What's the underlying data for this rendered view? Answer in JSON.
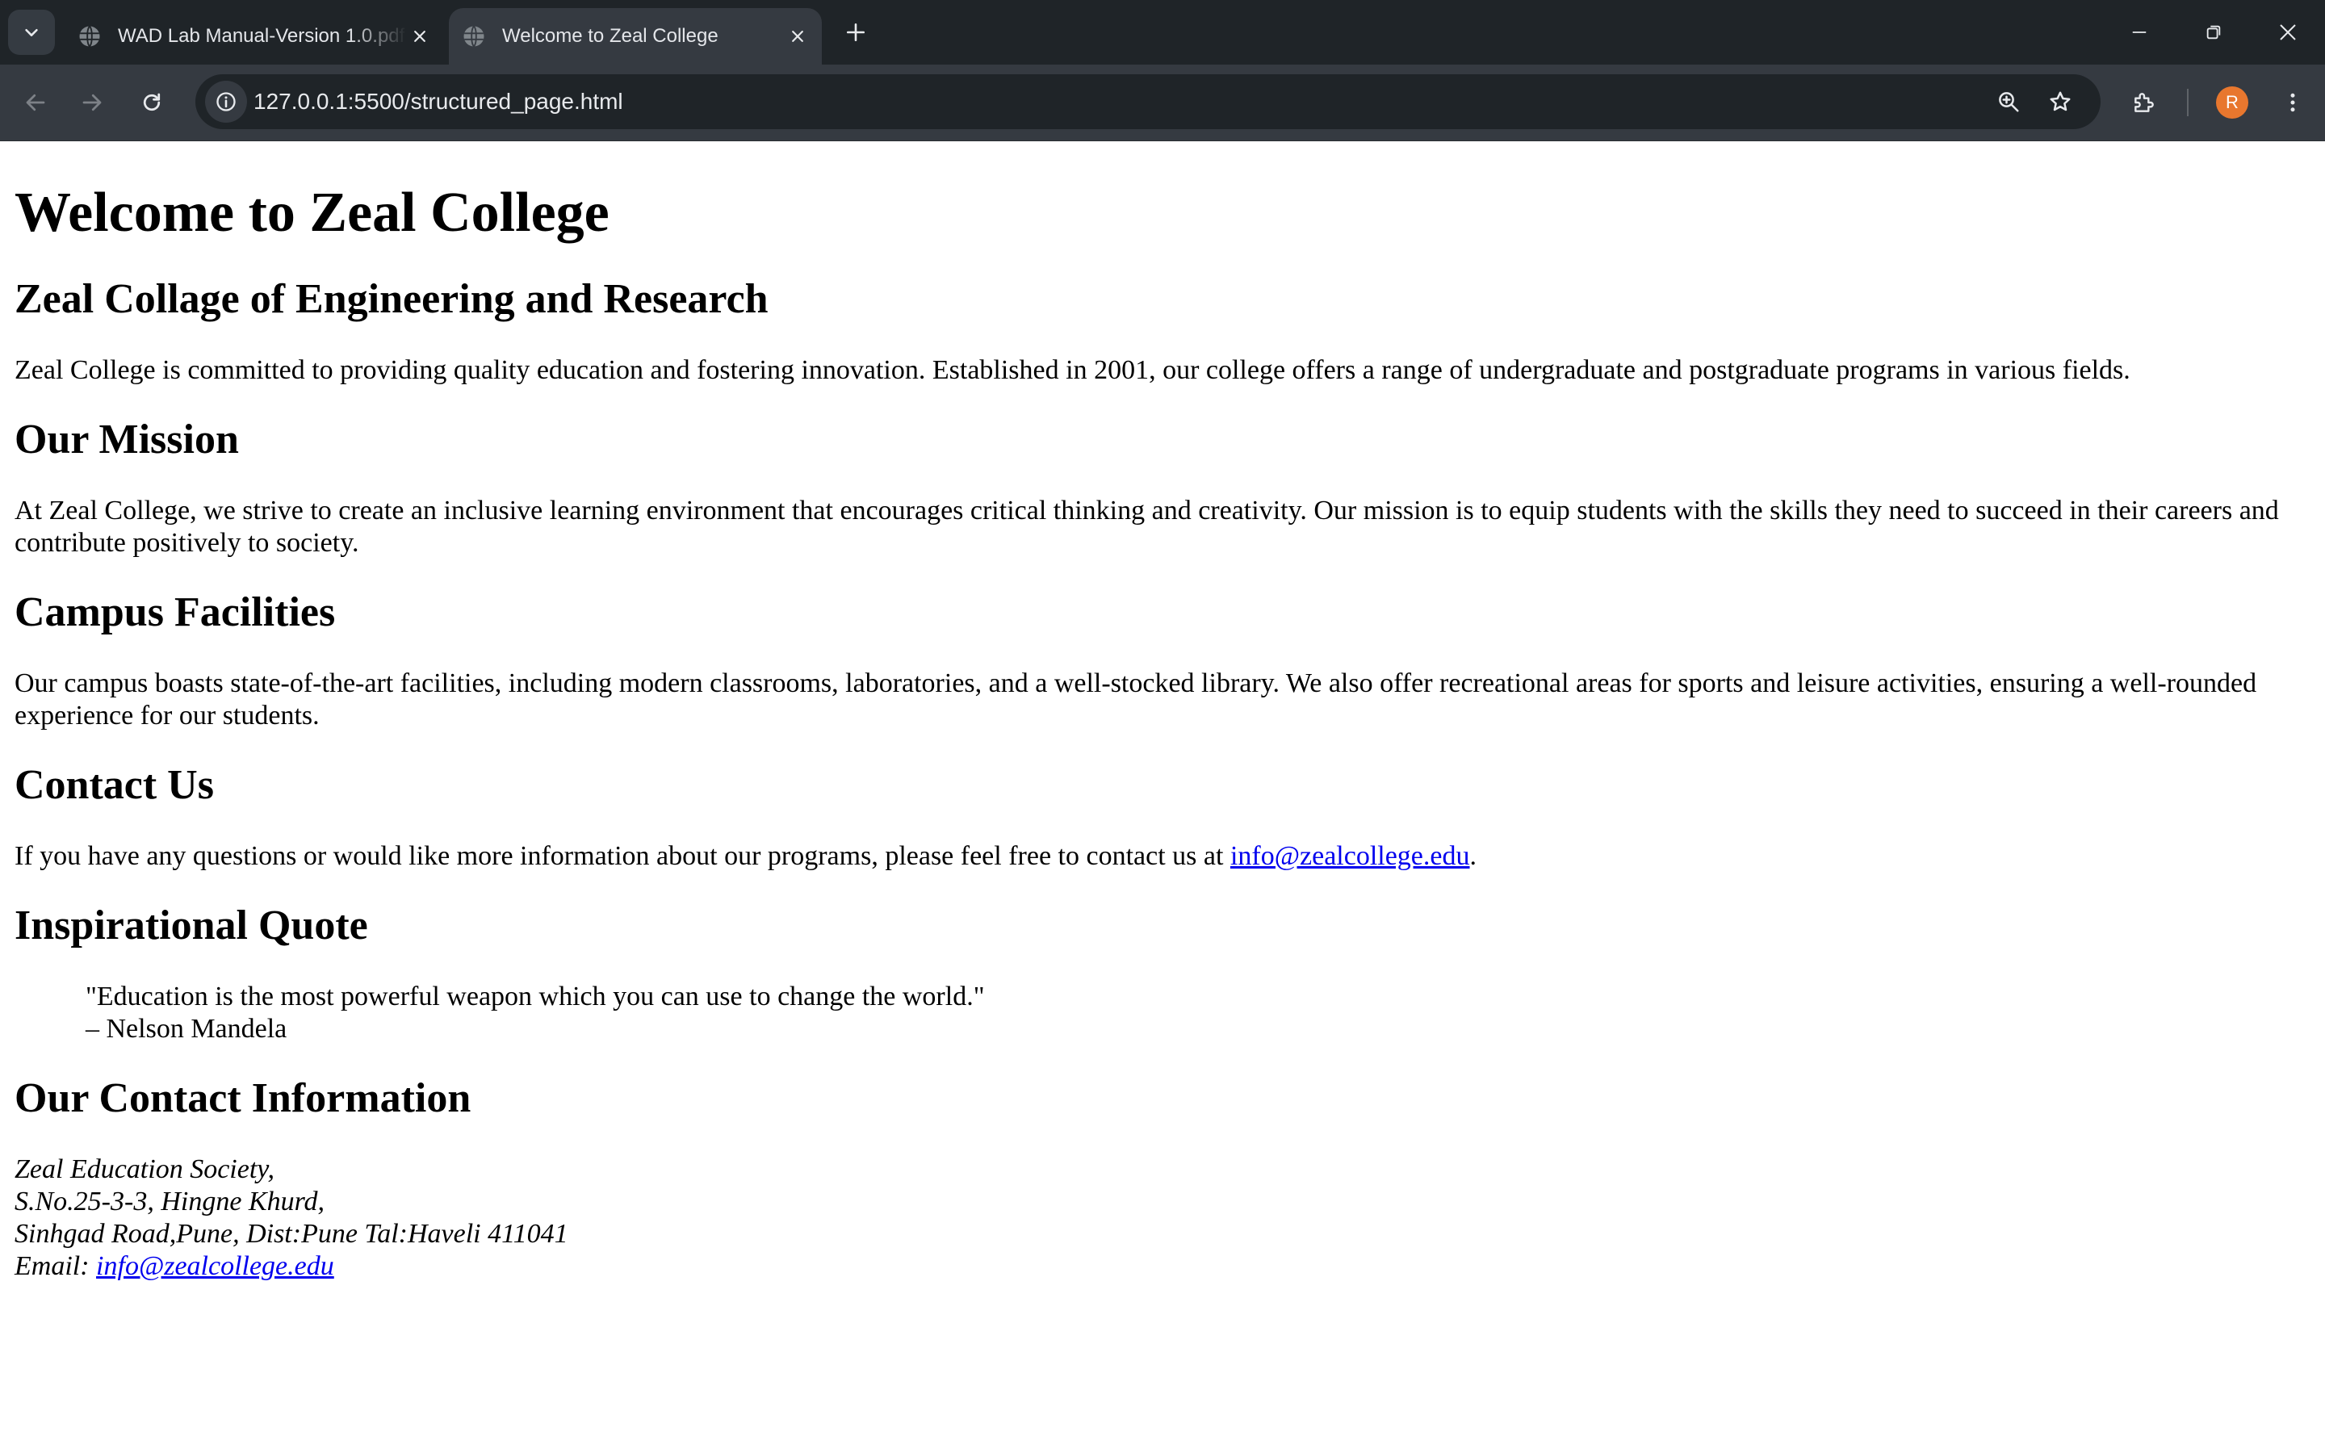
{
  "browser": {
    "tabs": [
      {
        "title": "WAD Lab Manual-Version 1.0.pdf",
        "active": false
      },
      {
        "title": "Welcome to Zeal College",
        "active": true
      }
    ],
    "url": "127.0.0.1:5500/structured_page.html",
    "profile_initial": "R",
    "colors": {
      "tabbar": "#1f2428",
      "toolbar": "#353a41",
      "avatar": "#e8772e",
      "link": "#0000ee"
    }
  },
  "page": {
    "title": "Welcome to Zeal College",
    "subtitle": "Zeal Collage of Engineering and Research",
    "intro": "Zeal College is committed to providing quality education and fostering innovation. Established in 2001, our college offers a range of undergraduate and postgraduate programs in various fields.",
    "mission": {
      "heading": "Our Mission",
      "text": "At Zeal College, we strive to create an inclusive learning environment that encourages critical thinking and creativity. Our mission is to equip students with the skills they need to succeed in their careers and contribute positively to society."
    },
    "facilities": {
      "heading": "Campus Facilities",
      "text": "Our campus boasts state-of-the-art facilities, including modern classrooms, laboratories, and a well-stocked library. We also offer recreational areas for sports and leisure activities, ensuring a well-rounded experience for our students."
    },
    "contact": {
      "heading": "Contact Us",
      "text_before": "If you have any questions or would like more information about our programs, please feel free to contact us at ",
      "email": "info@zealcollege.edu",
      "text_after": "."
    },
    "quote": {
      "heading": "Inspirational Quote",
      "text": "\"Education is the most powerful weapon which you can use to change the world.\"",
      "author": "– Nelson Mandela"
    },
    "contact_info": {
      "heading": "Our Contact Information",
      "line1": "Zeal Education Society,",
      "line2": "S.No.25-3-3, Hingne Khurd,",
      "line3": "Sinhgad Road,Pune, Dist:Pune Tal:Haveli 411041",
      "email_label": "Email: ",
      "email": "info@zealcollege.edu"
    }
  }
}
